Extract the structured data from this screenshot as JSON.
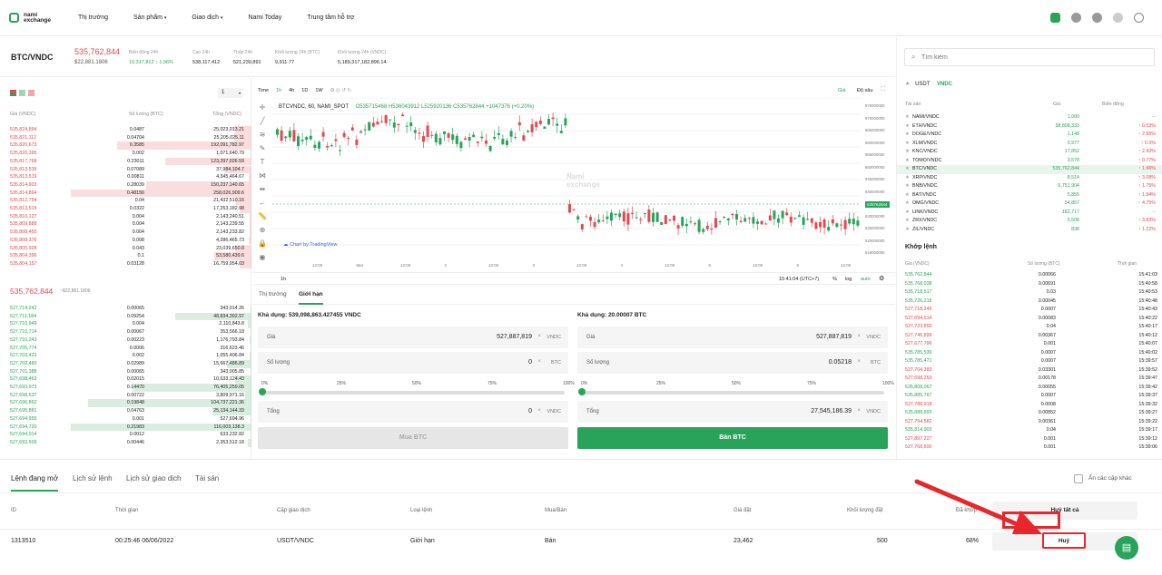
{
  "nav": {
    "logo_line1": "nami",
    "logo_line2": "exchange",
    "items": [
      "Thị trường",
      "Sản phẩm",
      "Giao dịch",
      "Nami Today",
      "Trung tâm hỗ trợ"
    ]
  },
  "ticker": {
    "pair": "BTC/VNDC",
    "price": "535,762,844",
    "usd": "$22,881.1806",
    "stats": [
      {
        "label": "Biến động 24h",
        "value": "10,317,812",
        "extra": "↑ 1.96%"
      },
      {
        "label": "Cao 24h",
        "value": "538,117,412"
      },
      {
        "label": "Thấp 24h",
        "value": "521,239,891"
      },
      {
        "label": "Khối lượng 24h (BTC)",
        "value": "9,911.77"
      },
      {
        "label": "Khối lượng 24h (VNDC)",
        "value": "5,189,317,182,896.14"
      }
    ]
  },
  "book": {
    "decimals": "1",
    "headers": [
      "Giá (VNDC)",
      "Số lượng (BTC)",
      "Tổng (VNDC)"
    ],
    "asks": [
      [
        "535,824,894",
        "0.0487",
        "25,023,013.21"
      ],
      [
        "535,821,112",
        "0.04704",
        "25,205,025.11"
      ],
      [
        "535,820,673",
        "0.3585",
        "192,091,782.97"
      ],
      [
        "535,820,395",
        "0.002",
        "1,071,640.79"
      ],
      [
        "535,817,768",
        "0.23011",
        "123,297,026.59"
      ],
      [
        "535,813,539",
        "0.07089",
        "37,984,104.7"
      ],
      [
        "535,813,519",
        "0.00811",
        "4,345,464.67"
      ],
      [
        "535,814,903",
        "0.28039",
        "150,237,140.65"
      ],
      [
        "535,814,864",
        "0.48156",
        "258,026,909.6"
      ],
      [
        "535,812,754",
        "0.04",
        "21,432,510.16"
      ],
      [
        "535,813,515",
        "0.0322",
        "17,253,182.98"
      ],
      [
        "535,810,127",
        "0.004",
        "2,143,240.51"
      ],
      [
        "535,809,888",
        "0.004",
        "2,143,239.55"
      ],
      [
        "535,808,455",
        "0.004",
        "2,143,233.82"
      ],
      [
        "535,808,376",
        "0.008",
        "4,286,465.73"
      ],
      [
        "535,805,928",
        "0.043",
        "23,039,650.8"
      ],
      [
        "535,804,396",
        "0.1",
        "53,580,439.6"
      ],
      [
        "535,804,157",
        "0.03128",
        "16,759,954.03"
      ]
    ],
    "mid_price": "535,762,844",
    "mid_usd": "~$22,881.1806",
    "bids": [
      [
        "527,714,242",
        "0.00065",
        "343,014.26"
      ],
      [
        "527,711,184",
        "0.09254",
        "48,834,392.97"
      ],
      [
        "527,710,949",
        "0.004",
        "2,110,843.8"
      ],
      [
        "527,710,714",
        "0.00067",
        "353,566.18"
      ],
      [
        "527,710,243",
        "0.00223",
        "1,176,793.84"
      ],
      [
        "527,705,774",
        "0.0006",
        "316,623.46"
      ],
      [
        "527,703,422",
        "0.002",
        "1,055,406.84"
      ],
      [
        "527,702,483",
        "0.02989",
        "15,667,486.89"
      ],
      [
        "527,701,388",
        "0.00065",
        "343,005.85"
      ],
      [
        "527,698,463",
        "0.02015",
        "10,633,124.43"
      ],
      [
        "527,693,973",
        "0.14470",
        "76,405,259.05"
      ],
      [
        "527,698,637",
        "0.00722",
        "3,809,971.16"
      ],
      [
        "527,696,862",
        "0.19848",
        "104,737,221.36"
      ],
      [
        "527,695,881",
        "0.04763",
        "25,134,144.33"
      ],
      [
        "527,694,955",
        "0.001",
        "527,694.96"
      ],
      [
        "527,694,720",
        "0.21983",
        "116,003,138.3"
      ],
      [
        "527,694,014",
        "0.0012",
        "633,232.82"
      ],
      [
        "527,693,509",
        "0.00446",
        "2,353,512.18"
      ]
    ]
  },
  "chart": {
    "intervals": [
      "Time",
      "1h",
      "4h",
      "1D",
      "1W"
    ],
    "view_tabs": [
      "Giá",
      "Độ sâu"
    ],
    "legend": "BTCVNDC, 60, NAMI_SPOT",
    "o": "O535715468",
    "h": "H536043912",
    "l": "L525920136",
    "c": "C535762844",
    "chg": "+1047376 (+0.20%)",
    "watermark": "Chart by TradingView",
    "x_labels": [
      "12:00",
      "Mar",
      "12:00",
      "2",
      "12:00",
      "3",
      "12:00",
      "4",
      "12:00",
      "5",
      "12:00",
      "6",
      "12:00"
    ],
    "y_labels": [
      "876000000",
      "870000000",
      "865000000",
      "860000000",
      "855000000",
      "850000000",
      "845000000",
      "540000000",
      "535000000",
      "530000000",
      "525000000",
      "520000000",
      "515000000"
    ],
    "price_tag": "535762844",
    "bottom_left": "1h",
    "time": "15:41:04 (UTC+7)",
    "pct": "%",
    "log": "log",
    "auto": "auto",
    "nami1": "Nami",
    "nami2": "exchange"
  },
  "trade": {
    "tabs": [
      "Thị trường",
      "Giới hạn"
    ],
    "buy": {
      "avail": "Khả dụng: 539,098,863.427455 VNDC",
      "price_label": "Giá",
      "price": "527,887,819",
      "price_unit": "VNDC",
      "qty_label": "Số lượng",
      "qty": "0",
      "qty_unit": "BTC",
      "total_label": "Tổng",
      "total": "0",
      "total_unit": "VNDC",
      "button": "Mua BTC"
    },
    "sell": {
      "avail": "Khả dụng: 20.00007 BTC",
      "price_label": "Giá",
      "price": "527,887,819",
      "price_unit": "VNDC",
      "qty_label": "Số lượng",
      "qty": "0.05218",
      "qty_unit": "BTC",
      "total_label": "Tổng",
      "total": "27,545,186.39",
      "total_unit": "VNDC",
      "button": "Bán BTC"
    },
    "pcts": [
      "0%",
      "25%",
      "50%",
      "75%",
      "100%"
    ],
    "x": "×"
  },
  "market": {
    "search_placeholder": "Tìm kiếm",
    "tabs": [
      "USDT",
      "VNDC"
    ],
    "headers": [
      "Tài sản",
      "Giá",
      "Biến động"
    ],
    "rows": [
      [
        "NAMI/VNDC",
        "1,000",
        "--"
      ],
      [
        "ETH/VNDC",
        "38,808,333",
        "↑ 0.03%"
      ],
      [
        "DOGE/VNDC",
        "1,148",
        "↑ 2.95%"
      ],
      [
        "XLM/VNDC",
        "3,977",
        "↑ 0.5%"
      ],
      [
        "KNC/VNDC",
        "17,852",
        "↑ 2.43%"
      ],
      [
        "TOMO/VNDC",
        "3,578",
        "↑ 0.77%"
      ],
      [
        "BTC/VNDC",
        "535,762,844",
        "↑ 1.96%"
      ],
      [
        "XRP/VNDC",
        "8,514",
        "↑ 3.08%"
      ],
      [
        "BNB/VNDC",
        "6,751,904",
        "↑ 1.75%"
      ],
      [
        "BAT/VNDC",
        "5,855",
        "↑ 1.94%"
      ],
      [
        "OMG/VNDC",
        "34,857",
        "↑ 4.75%"
      ],
      [
        "LINK/VNDC",
        "182,717",
        "--"
      ],
      [
        "ZRX/VNDC",
        "5,508",
        "↑ 3.83%"
      ],
      [
        "ZIL/VNDC",
        "838",
        "↑ 1.22%"
      ]
    ],
    "trades_title": "Khớp lệnh",
    "trades_headers": [
      "Giá (VNDC)",
      "Số lượng (BTC)",
      "Thời gian"
    ],
    "trades": [
      [
        "535,762,844",
        "0.00066",
        "15:41:03",
        "g"
      ],
      [
        "535,768,038",
        "0.00691",
        "15:40:58",
        "g"
      ],
      [
        "535,718,517",
        "0.03",
        "15:40:53",
        "g"
      ],
      [
        "535,726,218",
        "0.00045",
        "15:40:48",
        "g"
      ],
      [
        "527,718,249",
        "0.0007",
        "15:40:43",
        "r"
      ],
      [
        "527,694,014",
        "0.00083",
        "15:40:22",
        "r"
      ],
      [
        "527,723,850",
        "0.04",
        "15:40:17",
        "r"
      ],
      [
        "527,746,899",
        "0.00367",
        "15:40:12",
        "r"
      ],
      [
        "527,677,796",
        "0.001",
        "15:40:07",
        "r"
      ],
      [
        "535,785,530",
        "0.0007",
        "15:40:02",
        "g"
      ],
      [
        "535,785,471",
        "0.0007",
        "15:39:57",
        "g"
      ],
      [
        "527,704,383",
        "0.03301",
        "15:39:52",
        "r"
      ],
      [
        "527,698,253",
        "0.00178",
        "15:39:47",
        "r"
      ],
      [
        "535,808,067",
        "0.00055",
        "15:39:42",
        "g"
      ],
      [
        "535,885,767",
        "0.0007",
        "15:39:37",
        "g"
      ],
      [
        "527,788,918",
        "0.0008",
        "15:39:32",
        "r"
      ],
      [
        "535,888,892",
        "0.00852",
        "15:39:27",
        "g"
      ],
      [
        "527,794,582",
        "0.00361",
        "15:39:22",
        "r"
      ],
      [
        "535,814,903",
        "0.04",
        "15:39:17",
        "g"
      ],
      [
        "527,897,227",
        "0.001",
        "15:39:12",
        "r"
      ],
      [
        "527,768,600",
        "0.001",
        "15:39:06",
        "r"
      ]
    ]
  },
  "orders": {
    "tabs": [
      "Lệnh đang mở",
      "Lịch sử lệnh",
      "Lịch sử giao dịch",
      "Tài sản"
    ],
    "hide_other": "Ẩn các cặp khác",
    "headers": [
      "ID",
      "Thời gian",
      "Cặp giao dịch",
      "Loại lệnh",
      "Mua/Bán",
      "Giá đặt",
      "Khối lượng đặt",
      "Đã khớp"
    ],
    "cancel_all": "Huỷ tất cả",
    "row": {
      "id": "1313510",
      "time": "00:25:46 06/06/2022",
      "pair": "USDT/VNDC",
      "type": "Giới hạn",
      "side": "Bán",
      "price": "23,462",
      "qty": "500",
      "filled": "68%",
      "cancel": "Huỷ"
    }
  },
  "colors": {
    "green": "#2aa35a",
    "red": "#e5484d",
    "annotation": "#e8272c"
  }
}
